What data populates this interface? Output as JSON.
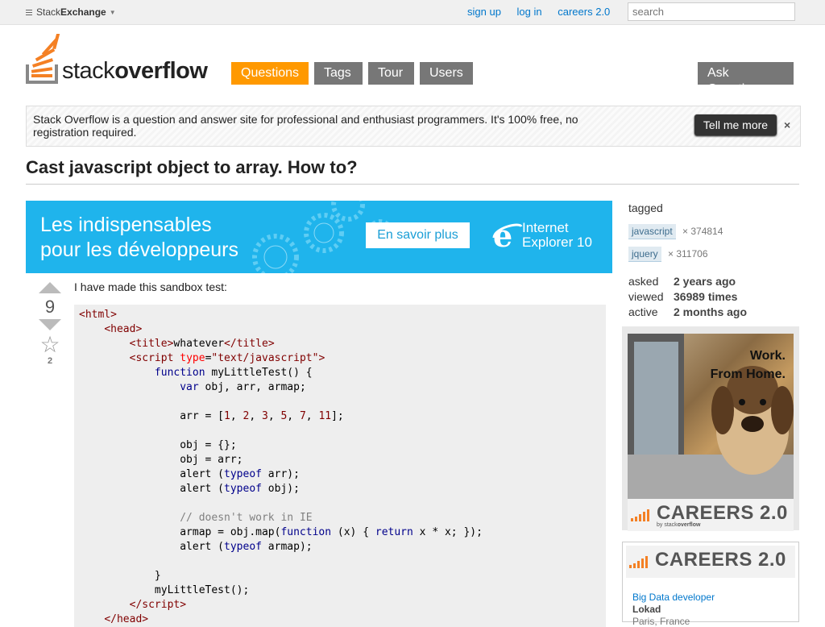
{
  "topbar": {
    "brand_prefix": "Stack",
    "brand_bold": "Exchange",
    "links": [
      "sign up",
      "log in",
      "careers 2.0"
    ],
    "search_placeholder": "search"
  },
  "logo": {
    "word_light": "stack",
    "word_bold": "overflow"
  },
  "nav": {
    "items": [
      "Questions",
      "Tags",
      "Tour",
      "Users"
    ],
    "ask": "Ask Question",
    "active": "Questions",
    "active_color": "#ff9900"
  },
  "intro": {
    "text": "Stack Overflow is a question and answer site for professional and enthusiast programmers. It's 100% free, no registration required.",
    "button": "Tell me more",
    "dismiss": "×"
  },
  "question": {
    "title": "Cast javascript object to array. How to?",
    "votes": "9",
    "favorites": "2",
    "body_intro": "I have made this sandbox test:"
  },
  "banner": {
    "line1": "Les indispensables",
    "line2": "pour les développeurs",
    "button": "En savoir plus",
    "product_line1": "Internet",
    "product_line2": "Explorer 10"
  },
  "sidebar": {
    "tagged_label": "tagged",
    "tags": [
      {
        "name": "javascript",
        "count": "× 374814"
      },
      {
        "name": "jquery",
        "count": "× 311706"
      }
    ],
    "stats": [
      {
        "label": "asked",
        "value": "2 years ago"
      },
      {
        "label": "viewed",
        "value": "36989 times"
      },
      {
        "label": "active",
        "value": "2 months ago"
      }
    ],
    "ad_headline1": "Work.",
    "ad_headline2": "From Home.",
    "careers": "CAREERS 2.0",
    "careers_by_prefix": "by stack",
    "careers_by_bold": "overflow",
    "job": {
      "title": "Big Data developer",
      "company": "Lokad",
      "location": "Paris, France"
    }
  }
}
